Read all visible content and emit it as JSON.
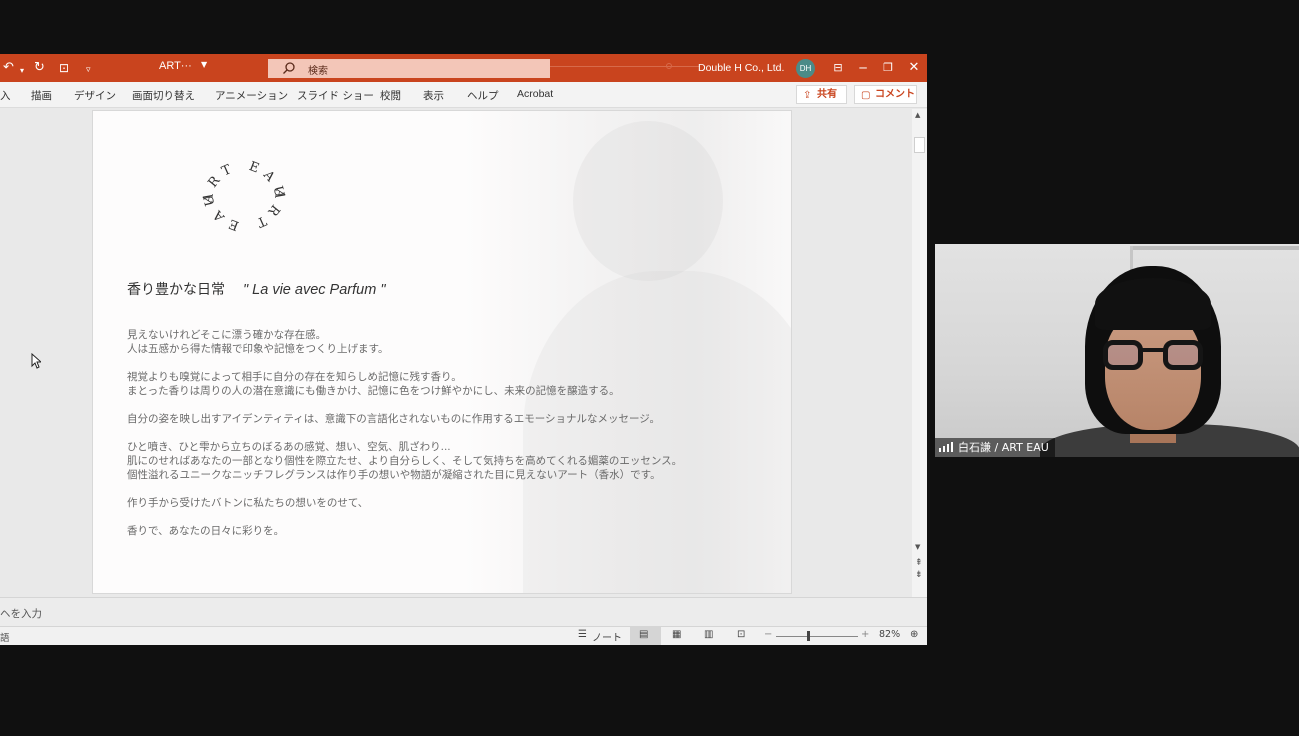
{
  "ppt": {
    "filename": "ART···",
    "search_placeholder": "検索",
    "company": "Double H Co., Ltd.",
    "user_initials": "DH",
    "ribbon_tabs": [
      "入",
      "描画",
      "デザイン",
      "画面切り替え",
      "アニメーション",
      "スライド ショー",
      "校閲",
      "表示",
      "ヘルプ",
      "Acrobat"
    ],
    "share_label": "共有",
    "comment_label": "コメント",
    "notes_placeholder": "ヘを入力",
    "status": {
      "language": "語",
      "notes_label": "ノート",
      "zoom_minus": "−",
      "zoom_plus": "+",
      "zoom": "82%"
    },
    "accent": "#c9441e"
  },
  "slide": {
    "logo_top": "ART EAU",
    "logo_bottom": "ART EAU",
    "title_jp": "香り豊かな日常",
    "title_fr": "\" La vie avec Parfum \"",
    "lines": [
      "見えないけれどそこに漂う確かな存在感。",
      "人は五感から得た情報で印象や記憶をつくり上げます。",
      "視覚よりも嗅覚によって相手に自分の存在を知らしめ記憶に残す香り。",
      "まとった香りは周りの人の潜在意識にも働きかけ、記憶に色をつけ鮮やかにし、未来の記憶を醸造する。",
      "自分の姿を映し出すアイデンティティは、意識下の言語化されないものに作用するエモーショナルなメッセージ。",
      "ひと噴き、ひと雫から立ちのぼるあの感覚、想い、空気、肌ざわり...",
      "肌にのせればあなたの一部となり個性を際立たせ、より自分らしく、そして気持ちを高めてくれる媚薬のエッセンス。",
      "個性溢れるユニークなニッチフレグランスは作り手の想いや物語が凝縮された目に見えないアート（香水）です。",
      "作り手から受けたバトンに私たちの想いをのせて、",
      "香りで、あなたの日々に彩りを。"
    ]
  },
  "video": {
    "participant": "白石謙 / ART EAU"
  }
}
